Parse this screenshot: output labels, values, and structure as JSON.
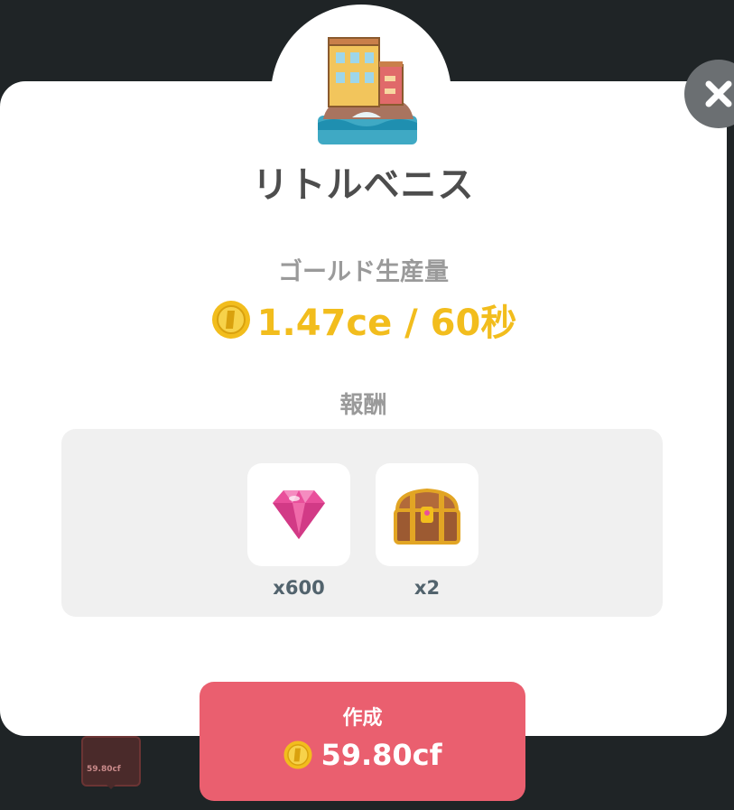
{
  "building": {
    "name": "リトルベニス",
    "icon": "venice-building-icon"
  },
  "production": {
    "label": "ゴールド生産量",
    "value": "1.47ce / 60秒",
    "icon": "gold-coin-icon"
  },
  "rewards": {
    "label": "報酬",
    "items": [
      {
        "icon": "pink-gem-icon",
        "count": "x600"
      },
      {
        "icon": "treasure-chest-icon",
        "count": "x2"
      }
    ]
  },
  "create_button": {
    "label": "作成",
    "price": "59.80cf",
    "icon": "gold-coin-icon"
  },
  "background": {
    "map_marker_text": "59.80cf"
  },
  "colors": {
    "gold": "#f2bd1d",
    "button": "#ea5f6f",
    "title": "#4d4d4d",
    "muted": "#9a9a9a"
  }
}
